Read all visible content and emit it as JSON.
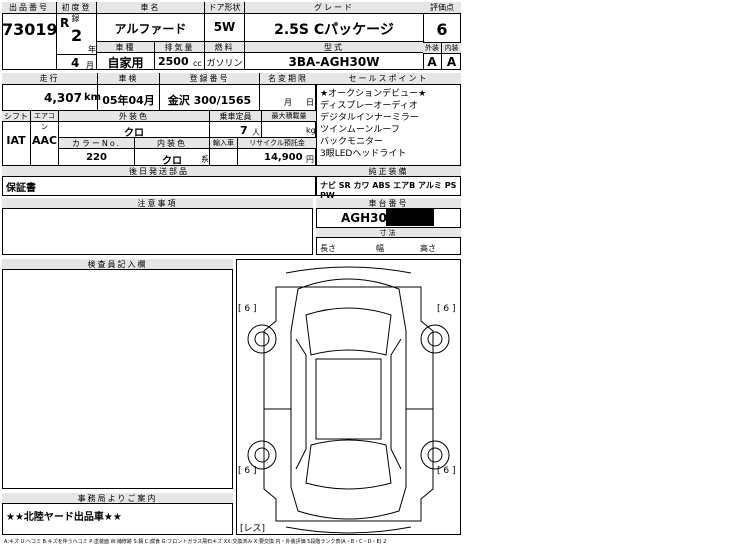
{
  "header_labels": {
    "lot_no": "出品番号",
    "first_reg": "初度登録",
    "car_name": "車名",
    "door": "ドア形状",
    "grade": "グレード",
    "score": "評価点",
    "year_unit": "年",
    "month_unit": "月",
    "category": "車種",
    "displacement": "排気量",
    "fuel": "燃料",
    "model": "型式",
    "exterior": "外装",
    "interior": "内装",
    "cc_unit": "cc"
  },
  "lot_no": "73019",
  "era": "R",
  "year": "2",
  "month": "4",
  "car_name": "アルファード",
  "door": "5W",
  "grade": "2.5S Cパッケージ",
  "score": "6",
  "category": "自家用",
  "displacement": "2500",
  "fuel": "ガソリン",
  "model": "3BA-AGH30W",
  "exterior_grade": "A",
  "interior_grade": "A",
  "row2_labels": {
    "mileage": "走行",
    "inspection": "車検",
    "registration": "登録番号",
    "expiry": "名変期限",
    "day_unit": "日",
    "month_unit": "月",
    "sales_points": "セールスポイント"
  },
  "mileage": "4,307",
  "mileage_unit": "km",
  "inspection_date": "05年04月",
  "registration_no": "金沢 300/1565",
  "row3_labels": {
    "shift": "シフト",
    "ac": "エアコン",
    "ext_color": "外装色",
    "capacity": "乗車定員",
    "max_load": "最大積載量",
    "color_no": "カラーNo.",
    "int_color": "内装色",
    "import": "輸入車",
    "recycle": "リサイクル預託金",
    "persons_unit": "人",
    "kg_unit": "kg",
    "yen_unit": "円",
    "series_unit": "系",
    "after_docs": "後日発送部品",
    "factory_equipment": "純正装備",
    "notes": "注意事項",
    "frame_no": "車台番号",
    "dimensions": "寸法",
    "length": "長さ",
    "width": "幅",
    "height": "高さ",
    "inspector_notes": "検査員記入欄",
    "office_notice": "事務局よりご案内"
  },
  "shift": "IAT",
  "ac": "AAC",
  "ext_color": "クロ",
  "capacity": "7",
  "color_no": "220",
  "int_color": "クロ",
  "recycle_fee": "14,900",
  "sales_points": [
    "★オークションデビュー★",
    "ディスプレーオーディオ",
    "デジタルインナーミラー",
    "ツインムーンルーフ",
    "バックモニター",
    "3眼LEDヘッドライト"
  ],
  "equipment": "ナビ SR カワ ABS エアB アルミ PS PW",
  "after_docs": "保証書",
  "frame_no": "AGH30-",
  "office_notice": "★★北陸ヤード出品車★★",
  "tire_marks": [
    "[ 6 ]",
    "[ 6 ]",
    "[ 6 ]",
    "[ 6 ]"
  ],
  "diagram_footer": "[レス]",
  "legend": "A:キズ U:ヘコミ B:キズを伴うヘコミ P:塗装面 W:補修跡 S:錆 C:腐食 G:フロントガラス飛石キズ XX:交換済み X:要交換 内・外装評価 5段階ランク表(A・B・C・D・E) 2"
}
